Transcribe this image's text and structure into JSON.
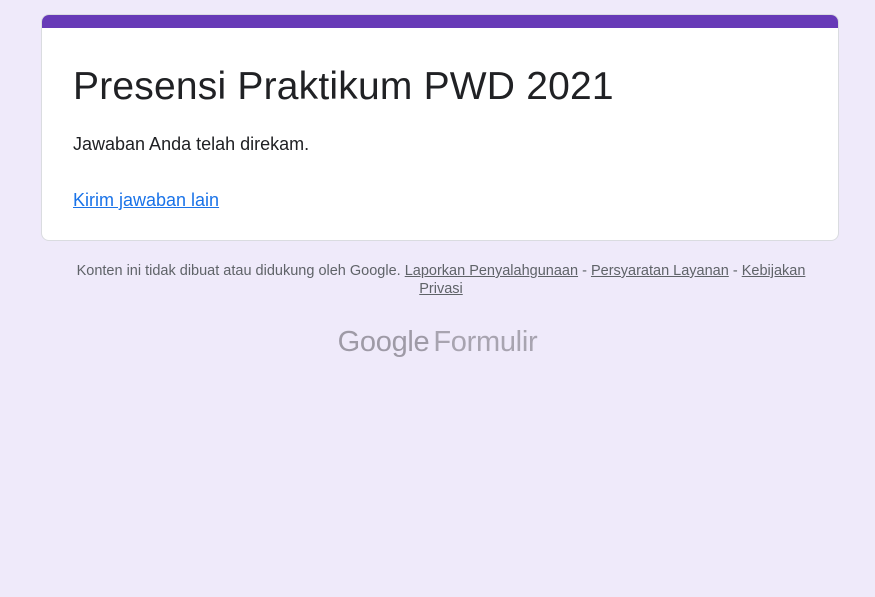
{
  "form": {
    "title": "Presensi Praktikum PWD 2021",
    "confirmation_message": "Jawaban Anda telah direkam.",
    "submit_another_link": "Kirim jawaban lain",
    "accent_color": "#673ab7"
  },
  "footer": {
    "disclaimer": "Konten ini tidak dibuat atau didukung oleh Google.",
    "report_abuse": "Laporkan Penyalahgunaan",
    "separator": "-",
    "terms": "Persyaratan Layanan",
    "privacy": "Kebijakan Privasi"
  },
  "brand": {
    "company": "Google",
    "product": "Formulir"
  },
  "colors": {
    "background": "#efeafa",
    "link": "#1a73e8"
  }
}
